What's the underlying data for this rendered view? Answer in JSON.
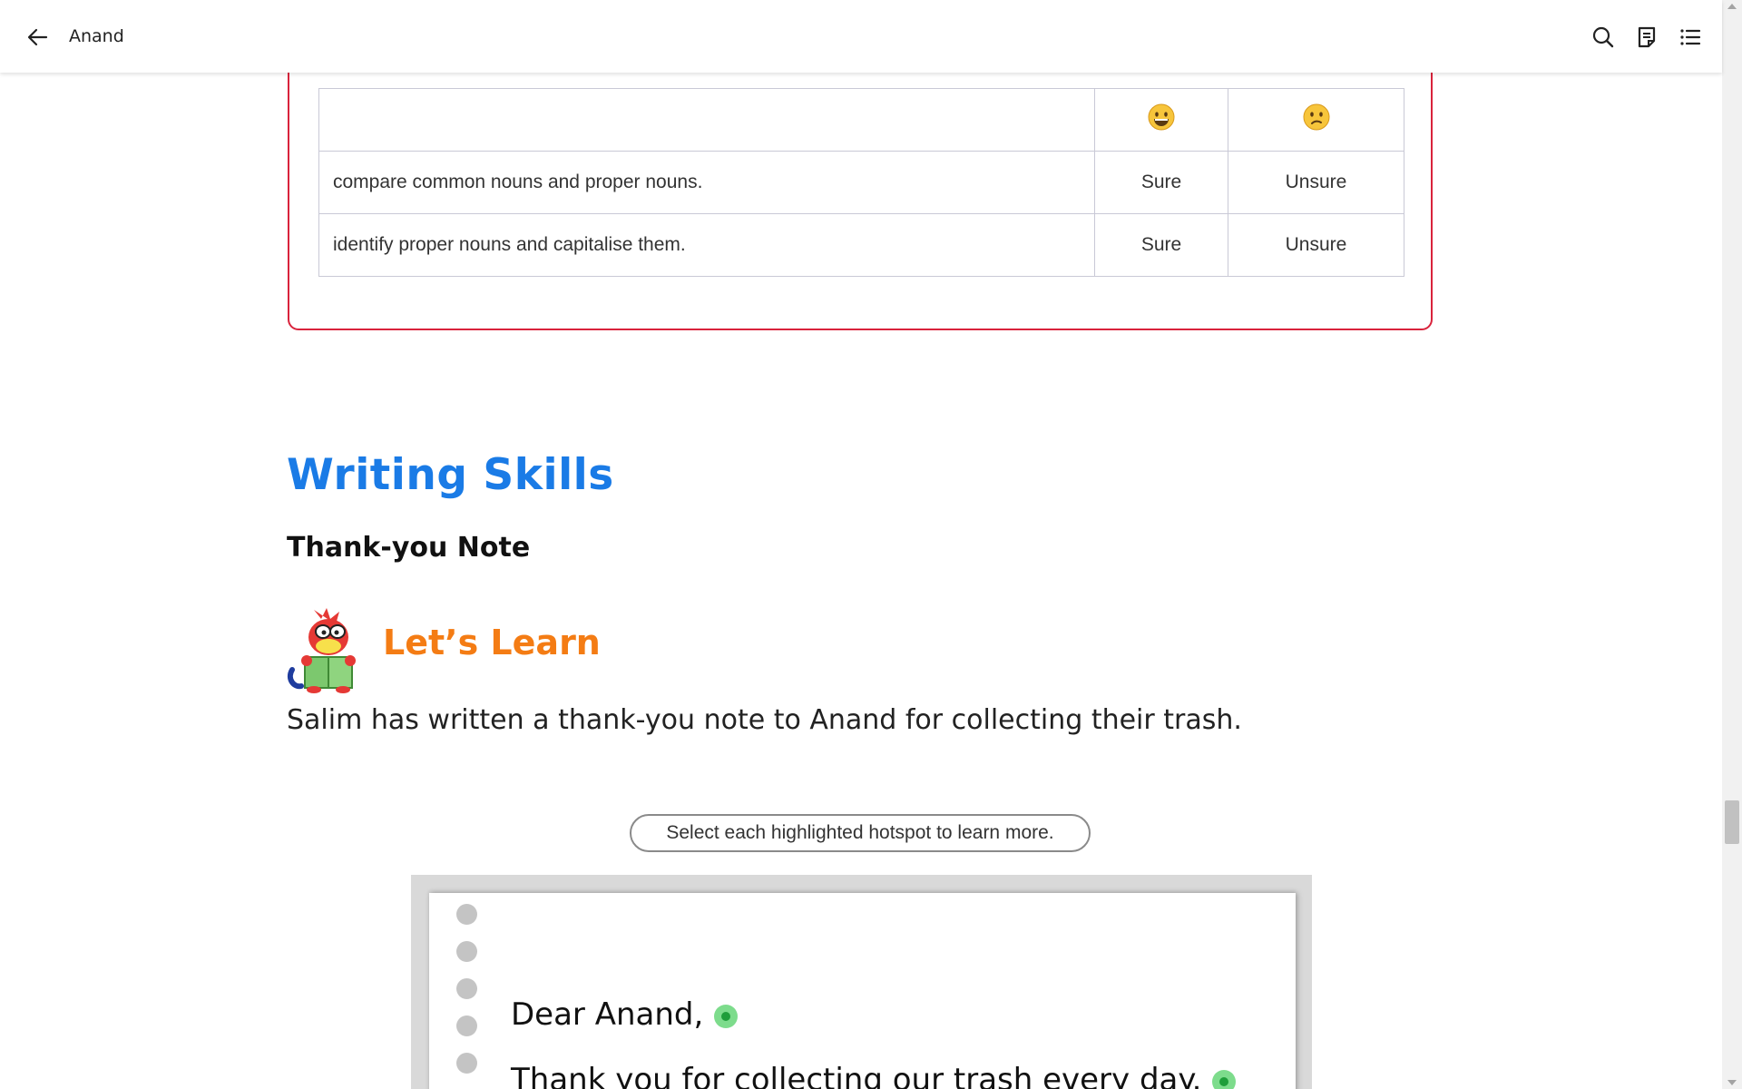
{
  "topbar": {
    "title": "Anand",
    "icons": [
      "back-arrow-icon",
      "search-icon",
      "notes-icon",
      "table-of-contents-icon"
    ]
  },
  "self_check": {
    "header_icons": [
      "grinning-face-emoji",
      "confused-face-emoji"
    ],
    "header_glyphs": [
      "😀",
      "😕"
    ],
    "rows": [
      {
        "statement": "compare common nouns and proper nouns.",
        "option_a": "Sure",
        "option_b": "Unsure"
      },
      {
        "statement": "identify proper nouns and capitalise them.",
        "option_a": "Sure",
        "option_b": "Unsure"
      }
    ],
    "border_color": "#d9233c"
  },
  "section": {
    "title": "Writing Skills",
    "title_color": "#1a7be6",
    "subtitle": "Thank-you Note",
    "feature_label": "Let’s Learn",
    "feature_color": "#f47c14",
    "lead_text": "Salim has written a thank-you note to Anand for collecting their trash."
  },
  "hotspot_prompt": "Select each highlighted hotspot to learn more.",
  "note": {
    "lines": [
      "Dear Anand,",
      "Thank you for collecting our trash every day."
    ]
  }
}
